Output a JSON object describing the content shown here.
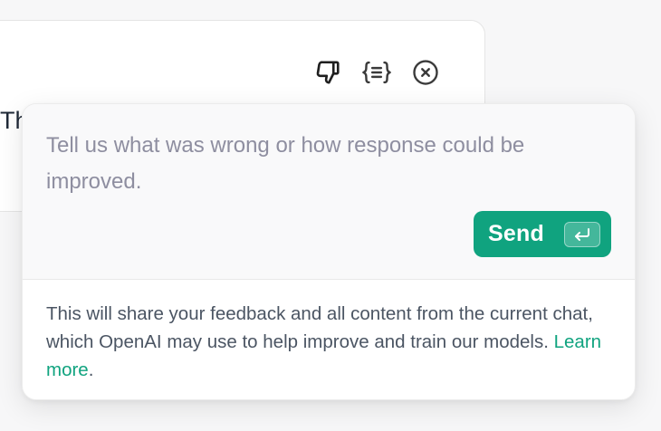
{
  "background": {
    "partial_text": "Th"
  },
  "toolbar": {
    "icons": [
      "thumbs-down-icon",
      "curly-braces-icon",
      "close-circle-icon"
    ]
  },
  "feedback": {
    "placeholder": "Tell us what was wrong or how response could be improved.",
    "value": "",
    "send_label": "Send",
    "send_icon": "enter-key-icon",
    "disclaimer_text": "This will share your feedback and all content from the current chat, which OpenAI may use to help improve and train our models. ",
    "learn_more_label": "Learn more",
    "disclaimer_end": "."
  },
  "colors": {
    "accent": "#10a37f",
    "placeholder": "#8e8ea0",
    "body_text": "#4b5563",
    "background": "#f7f7f8"
  }
}
